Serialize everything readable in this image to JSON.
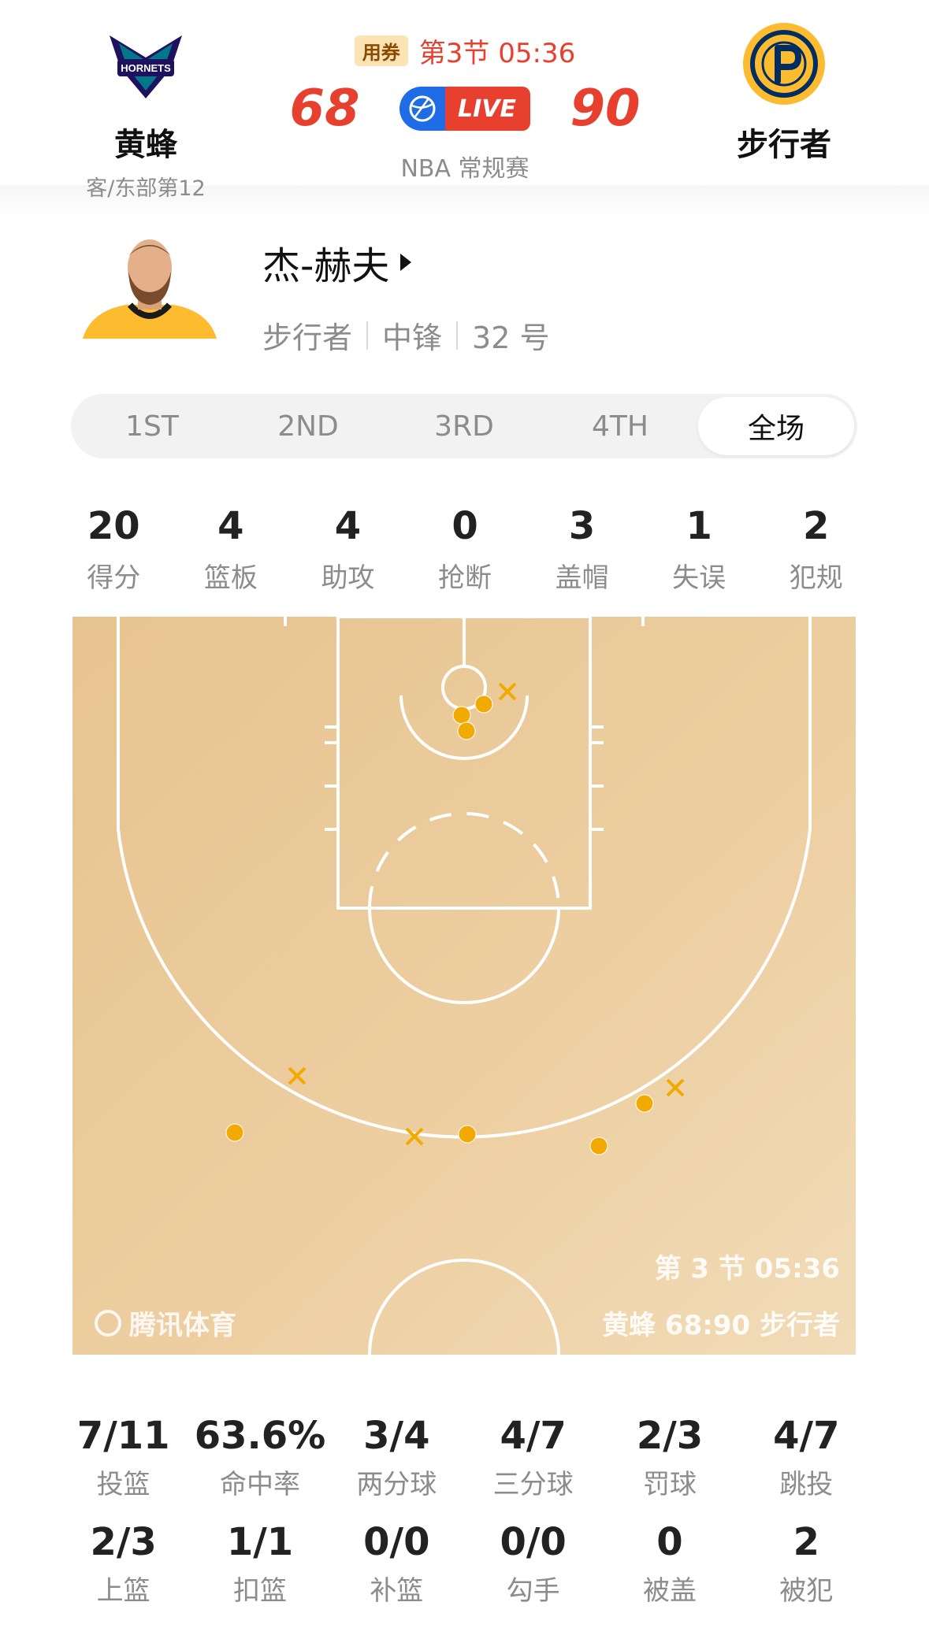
{
  "header": {
    "away": {
      "name": "黄蜂",
      "sub": "客/东部第12",
      "logo_icon": "hornets-logo-icon"
    },
    "home": {
      "name": "步行者",
      "logo_icon": "pacers-logo-icon"
    },
    "coupon": "用券",
    "period": "第3节 05:36",
    "away_score": "68",
    "home_score": "90",
    "live": "LIVE",
    "game_type": "NBA 常规赛"
  },
  "player": {
    "name": "杰-赫夫",
    "team": "步行者",
    "position": "中锋",
    "number": "32 号"
  },
  "tabs": [
    {
      "label": "1ST"
    },
    {
      "label": "2ND"
    },
    {
      "label": "3RD"
    },
    {
      "label": "4TH"
    },
    {
      "label": "全场",
      "active": true
    }
  ],
  "stats": [
    {
      "value": "20",
      "label": "得分"
    },
    {
      "value": "4",
      "label": "篮板"
    },
    {
      "value": "4",
      "label": "助攻"
    },
    {
      "value": "0",
      "label": "抢断"
    },
    {
      "value": "3",
      "label": "盖帽"
    },
    {
      "value": "1",
      "label": "失误"
    },
    {
      "value": "2",
      "label": "犯规"
    }
  ],
  "court": {
    "brand": "腾讯体育",
    "time": "第 3 节 05:36",
    "score_line": "黄蜂 68:90 步行者",
    "made_color": "#f2a900",
    "miss_color": "#f2a900"
  },
  "shots_row1": [
    {
      "value": "7/11",
      "label": "投篮"
    },
    {
      "value": "63.6%",
      "label": "命中率"
    },
    {
      "value": "3/4",
      "label": "两分球"
    },
    {
      "value": "4/7",
      "label": "三分球"
    },
    {
      "value": "2/3",
      "label": "罚球"
    },
    {
      "value": "4/7",
      "label": "跳投"
    }
  ],
  "shots_row2": [
    {
      "value": "2/3",
      "label": "上篮"
    },
    {
      "value": "1/1",
      "label": "扣篮"
    },
    {
      "value": "0/0",
      "label": "补篮"
    },
    {
      "value": "0/0",
      "label": "勾手"
    },
    {
      "value": "0",
      "label": "被盖"
    },
    {
      "value": "2",
      "label": "被犯"
    }
  ]
}
